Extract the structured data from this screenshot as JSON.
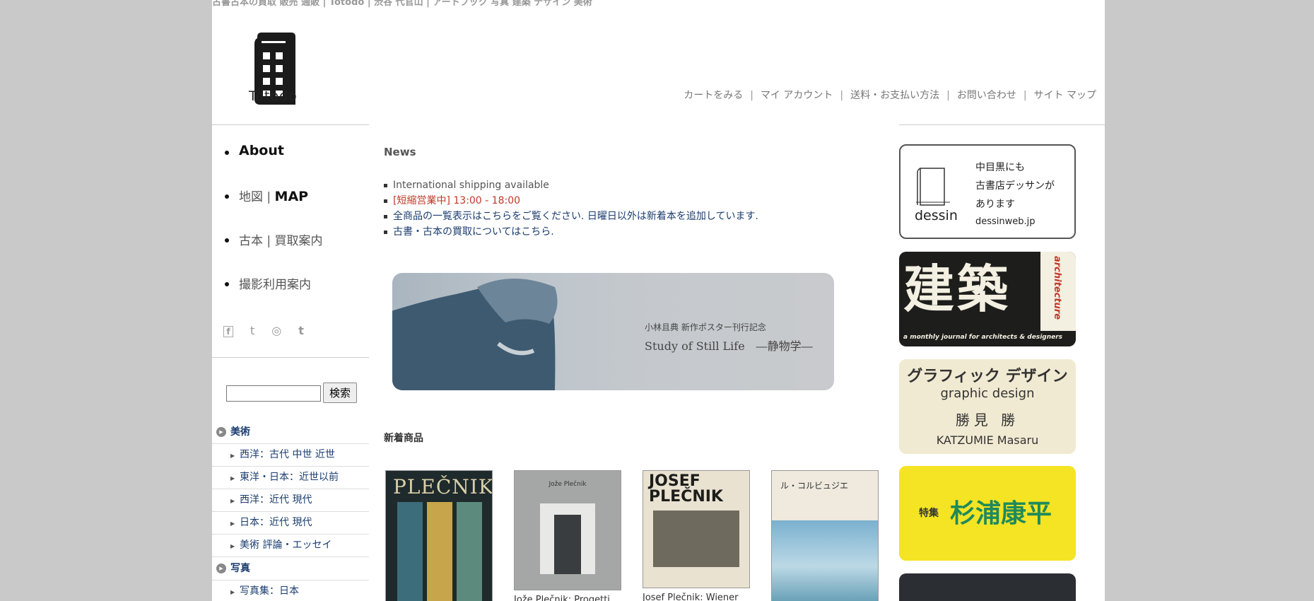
{
  "site_title": "古書古本の買取 販売 通販 | Totodo | 渋谷 代官山 | アートブック 写真 建築 デザイン 美術",
  "logo_text": "Totodo",
  "header_nav": [
    "カートをみる",
    "マイ アカウント",
    "送料・お支払い方法",
    "お問い合わせ",
    "サイト マップ"
  ],
  "main_nav": {
    "about": "About",
    "map_jp": "地図",
    "map_en": "MAP",
    "kaitori": "古本 | 買取案内",
    "satsuei": "撮影利用案内"
  },
  "social": {
    "facebook": "f",
    "twitter": "t",
    "instagram": "◎",
    "tumblr": "t"
  },
  "search": {
    "button": "検索",
    "value": ""
  },
  "categories": {
    "art": {
      "label": "美術",
      "items": [
        "西洋：古代 中世 近世",
        "東洋・日本：近世以前",
        "西洋：近代 現代",
        "日本：近代 現代",
        "美術 評論・エッセイ"
      ]
    },
    "photo": {
      "label": "写真",
      "items": [
        "写真集：日本"
      ]
    }
  },
  "news": {
    "title": "News",
    "items": [
      "International shipping available",
      "[短縮営業中] 13:00 - 18:00",
      "全商品の一覧表示はこちらをご覧ください. 日曜日以外は新着本を追加しています.",
      "古書・古本の買取についてはこちら."
    ]
  },
  "banner": {
    "sub": "小林且典 新作ポスター刊行記念",
    "main": "Study of Still Life　―静物学―"
  },
  "new_arrivals": {
    "title": "新着商品",
    "products": [
      {
        "cover_text": "PLEČNIK",
        "title": ""
      },
      {
        "cover_text": "Jože Plečnik",
        "title": "Jože Plečnik: Progetti"
      },
      {
        "cover_text": "JOSEF PLEČNIK",
        "title": "Josef Plečnik: Wiener"
      },
      {
        "cover_text": "ル・コルビュジエ",
        "title": ""
      }
    ]
  },
  "side_ads": {
    "dessin": {
      "brand": "dessin",
      "line1": "中目黒にも",
      "line2": "古書店デッサンが",
      "line3": "あります",
      "url": "dessinweb.jp"
    },
    "kenchiku": {
      "big": "建築",
      "vertical": "architecture",
      "tagline": "a monthly journal for architects & designers"
    },
    "graphic": {
      "line1": "グラフィック デザイン",
      "line2": "graphic design",
      "line3": "勝見 勝",
      "line4": "KATZUMIE Masaru"
    },
    "sugiura": {
      "prefix": "特集",
      "name": "杉浦康平"
    }
  },
  "colors": {
    "link": "#1a3c6e",
    "alert": "#c0392b",
    "background": "#c9c9c9"
  }
}
